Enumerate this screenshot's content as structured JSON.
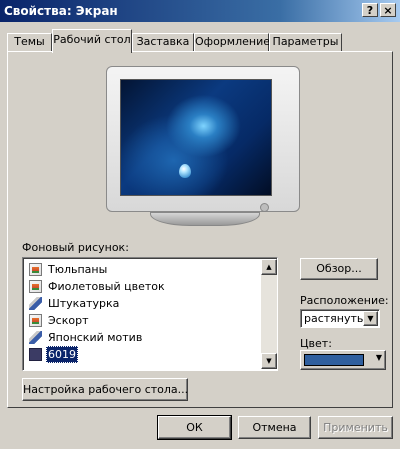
{
  "window": {
    "title": "Свойства: Экран",
    "help_button": "?",
    "close_button": "×"
  },
  "tabs": [
    {
      "label": "Темы"
    },
    {
      "label": "Рабочий стол"
    },
    {
      "label": "Заставка"
    },
    {
      "label": "Оформление"
    },
    {
      "label": "Параметры"
    }
  ],
  "desktop": {
    "background_label": "Фоновый рисунок:",
    "backgrounds": [
      {
        "label": "Тюльпаны",
        "icon": "image-file-icon"
      },
      {
        "label": "Фиолетовый цветок",
        "icon": "image-file-icon"
      },
      {
        "label": "Штукатурка",
        "icon": "texture-brush-icon"
      },
      {
        "label": "Эскорт",
        "icon": "image-file-icon"
      },
      {
        "label": "Японский мотив",
        "icon": "texture-brush-icon"
      },
      {
        "label": "6019",
        "icon": "bitmap-file-icon",
        "selected": true
      }
    ],
    "browse_button": "Обзор...",
    "position_label": "Расположение:",
    "position_value": "растянуть",
    "color_label": "Цвет:",
    "color_value": "#2f5f9e",
    "customize_button": "Настройка рабочего стола..."
  },
  "footer": {
    "ok": "ОК",
    "cancel": "Отмена",
    "apply": "Применить"
  }
}
